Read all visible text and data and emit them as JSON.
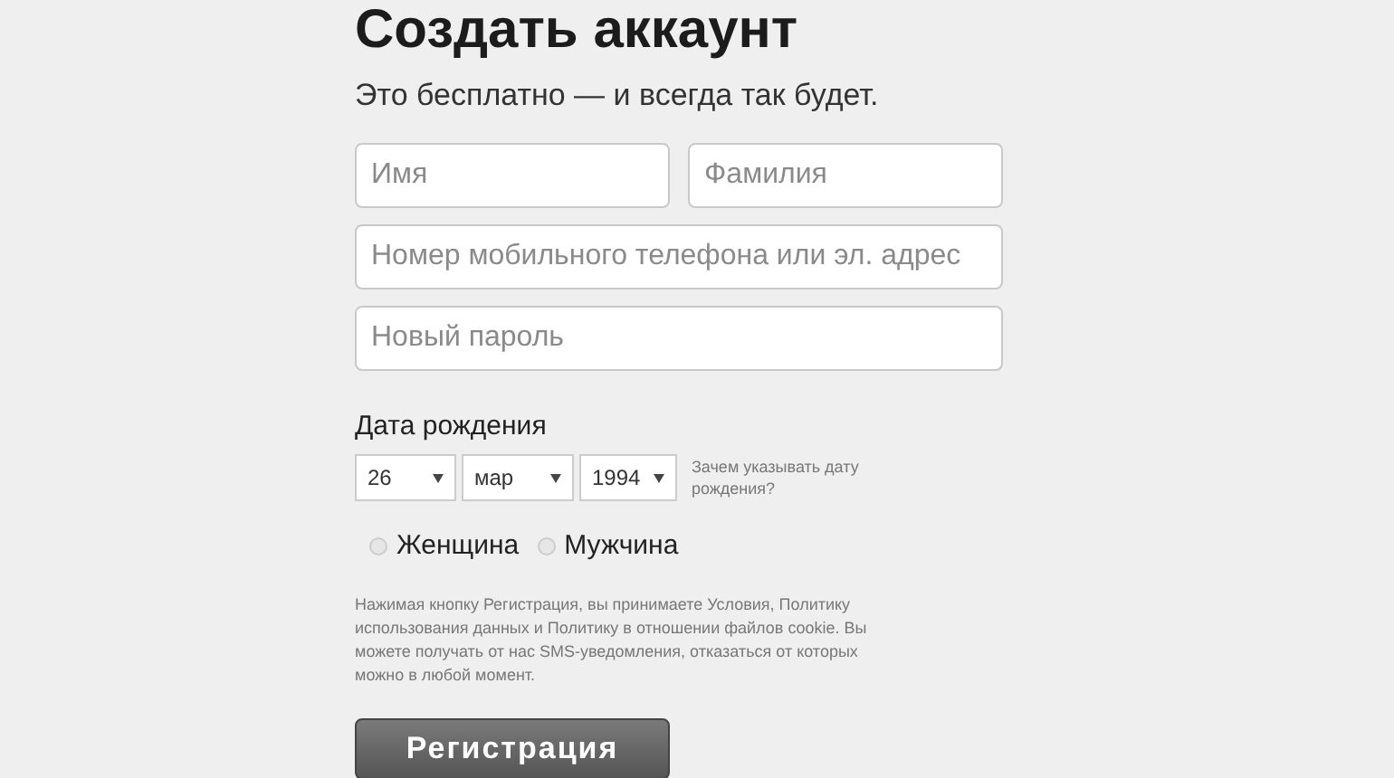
{
  "title": "Создать аккаунт",
  "subtitle": "Это бесплатно — и всегда так будет.",
  "fields": [
    {
      "placeholder": "Имя"
    },
    {
      "placeholder": "Фамилия"
    },
    {
      "placeholder": "Номер мобильного телефона или эл. адрес"
    },
    {
      "placeholder": "Новый пароль"
    }
  ],
  "birthday": {
    "label": "Дата рождения",
    "selects": [
      {
        "value": "26"
      },
      {
        "value": "мар"
      },
      {
        "value": "1994"
      }
    ],
    "hint": "Зачем указывать дату рождения?"
  },
  "gender": [
    {
      "label": "Женщина",
      "selected": false
    },
    {
      "label": "Мужчина",
      "selected": false
    }
  ],
  "terms": "Нажимая кнопку Регистрация, вы принимаете Условия, Политику использования данных и Политику в отношении файлов cookie. Вы можете получать от нас SMS-уведомления, отказаться от которых можно в любой момент.",
  "submit": "Регистрация"
}
